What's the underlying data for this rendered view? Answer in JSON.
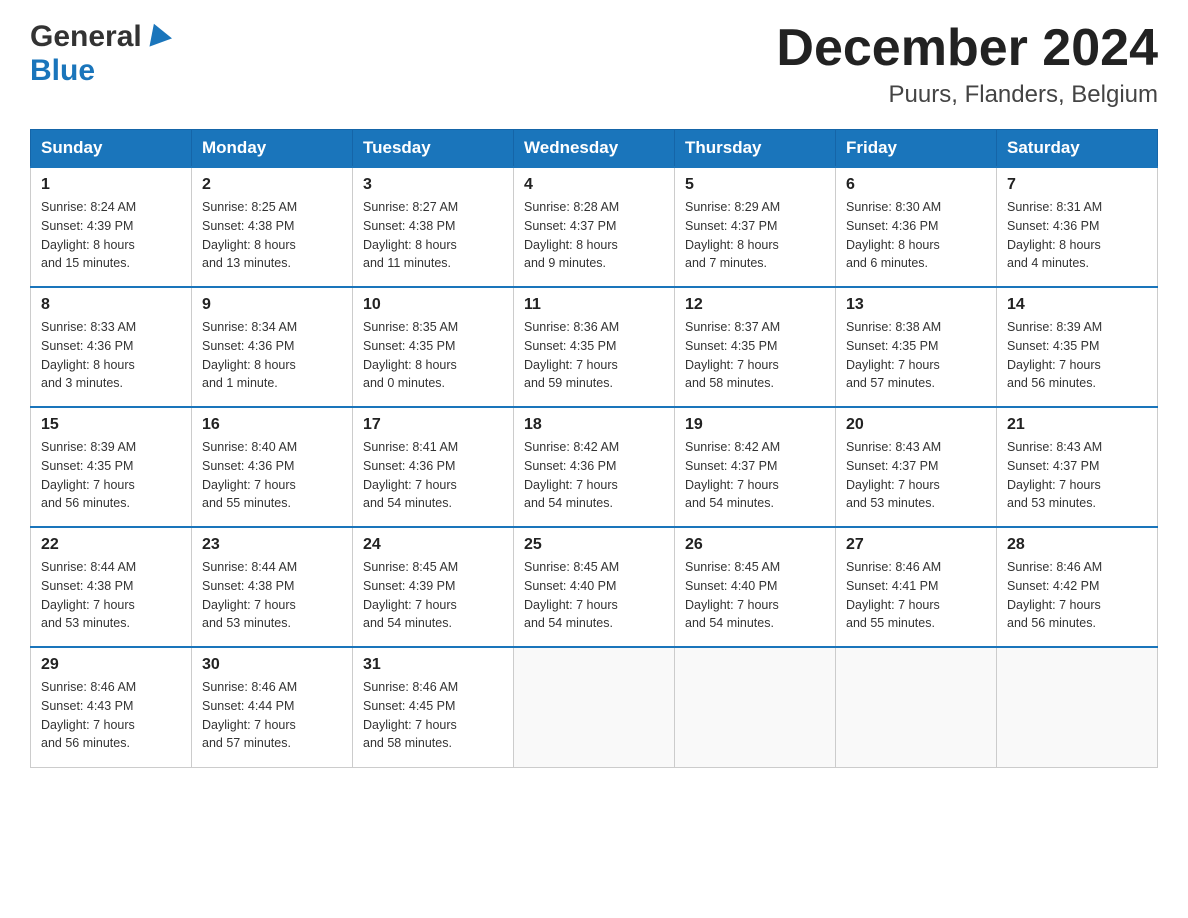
{
  "header": {
    "logo_general": "General",
    "logo_blue": "Blue",
    "month_year": "December 2024",
    "location": "Puurs, Flanders, Belgium"
  },
  "days_of_week": [
    "Sunday",
    "Monday",
    "Tuesday",
    "Wednesday",
    "Thursday",
    "Friday",
    "Saturday"
  ],
  "weeks": [
    [
      {
        "day": "1",
        "sunrise": "8:24 AM",
        "sunset": "4:39 PM",
        "daylight": "8 hours and 15 minutes."
      },
      {
        "day": "2",
        "sunrise": "8:25 AM",
        "sunset": "4:38 PM",
        "daylight": "8 hours and 13 minutes."
      },
      {
        "day": "3",
        "sunrise": "8:27 AM",
        "sunset": "4:38 PM",
        "daylight": "8 hours and 11 minutes."
      },
      {
        "day": "4",
        "sunrise": "8:28 AM",
        "sunset": "4:37 PM",
        "daylight": "8 hours and 9 minutes."
      },
      {
        "day": "5",
        "sunrise": "8:29 AM",
        "sunset": "4:37 PM",
        "daylight": "8 hours and 7 minutes."
      },
      {
        "day": "6",
        "sunrise": "8:30 AM",
        "sunset": "4:36 PM",
        "daylight": "8 hours and 6 minutes."
      },
      {
        "day": "7",
        "sunrise": "8:31 AM",
        "sunset": "4:36 PM",
        "daylight": "8 hours and 4 minutes."
      }
    ],
    [
      {
        "day": "8",
        "sunrise": "8:33 AM",
        "sunset": "4:36 PM",
        "daylight": "8 hours and 3 minutes."
      },
      {
        "day": "9",
        "sunrise": "8:34 AM",
        "sunset": "4:36 PM",
        "daylight": "8 hours and 1 minute."
      },
      {
        "day": "10",
        "sunrise": "8:35 AM",
        "sunset": "4:35 PM",
        "daylight": "8 hours and 0 minutes."
      },
      {
        "day": "11",
        "sunrise": "8:36 AM",
        "sunset": "4:35 PM",
        "daylight": "7 hours and 59 minutes."
      },
      {
        "day": "12",
        "sunrise": "8:37 AM",
        "sunset": "4:35 PM",
        "daylight": "7 hours and 58 minutes."
      },
      {
        "day": "13",
        "sunrise": "8:38 AM",
        "sunset": "4:35 PM",
        "daylight": "7 hours and 57 minutes."
      },
      {
        "day": "14",
        "sunrise": "8:39 AM",
        "sunset": "4:35 PM",
        "daylight": "7 hours and 56 minutes."
      }
    ],
    [
      {
        "day": "15",
        "sunrise": "8:39 AM",
        "sunset": "4:35 PM",
        "daylight": "7 hours and 56 minutes."
      },
      {
        "day": "16",
        "sunrise": "8:40 AM",
        "sunset": "4:36 PM",
        "daylight": "7 hours and 55 minutes."
      },
      {
        "day": "17",
        "sunrise": "8:41 AM",
        "sunset": "4:36 PM",
        "daylight": "7 hours and 54 minutes."
      },
      {
        "day": "18",
        "sunrise": "8:42 AM",
        "sunset": "4:36 PM",
        "daylight": "7 hours and 54 minutes."
      },
      {
        "day": "19",
        "sunrise": "8:42 AM",
        "sunset": "4:37 PM",
        "daylight": "7 hours and 54 minutes."
      },
      {
        "day": "20",
        "sunrise": "8:43 AM",
        "sunset": "4:37 PM",
        "daylight": "7 hours and 53 minutes."
      },
      {
        "day": "21",
        "sunrise": "8:43 AM",
        "sunset": "4:37 PM",
        "daylight": "7 hours and 53 minutes."
      }
    ],
    [
      {
        "day": "22",
        "sunrise": "8:44 AM",
        "sunset": "4:38 PM",
        "daylight": "7 hours and 53 minutes."
      },
      {
        "day": "23",
        "sunrise": "8:44 AM",
        "sunset": "4:38 PM",
        "daylight": "7 hours and 53 minutes."
      },
      {
        "day": "24",
        "sunrise": "8:45 AM",
        "sunset": "4:39 PM",
        "daylight": "7 hours and 54 minutes."
      },
      {
        "day": "25",
        "sunrise": "8:45 AM",
        "sunset": "4:40 PM",
        "daylight": "7 hours and 54 minutes."
      },
      {
        "day": "26",
        "sunrise": "8:45 AM",
        "sunset": "4:40 PM",
        "daylight": "7 hours and 54 minutes."
      },
      {
        "day": "27",
        "sunrise": "8:46 AM",
        "sunset": "4:41 PM",
        "daylight": "7 hours and 55 minutes."
      },
      {
        "day": "28",
        "sunrise": "8:46 AM",
        "sunset": "4:42 PM",
        "daylight": "7 hours and 56 minutes."
      }
    ],
    [
      {
        "day": "29",
        "sunrise": "8:46 AM",
        "sunset": "4:43 PM",
        "daylight": "7 hours and 56 minutes."
      },
      {
        "day": "30",
        "sunrise": "8:46 AM",
        "sunset": "4:44 PM",
        "daylight": "7 hours and 57 minutes."
      },
      {
        "day": "31",
        "sunrise": "8:46 AM",
        "sunset": "4:45 PM",
        "daylight": "7 hours and 58 minutes."
      },
      null,
      null,
      null,
      null
    ]
  ],
  "labels": {
    "sunrise": "Sunrise:",
    "sunset": "Sunset:",
    "daylight": "Daylight:"
  }
}
